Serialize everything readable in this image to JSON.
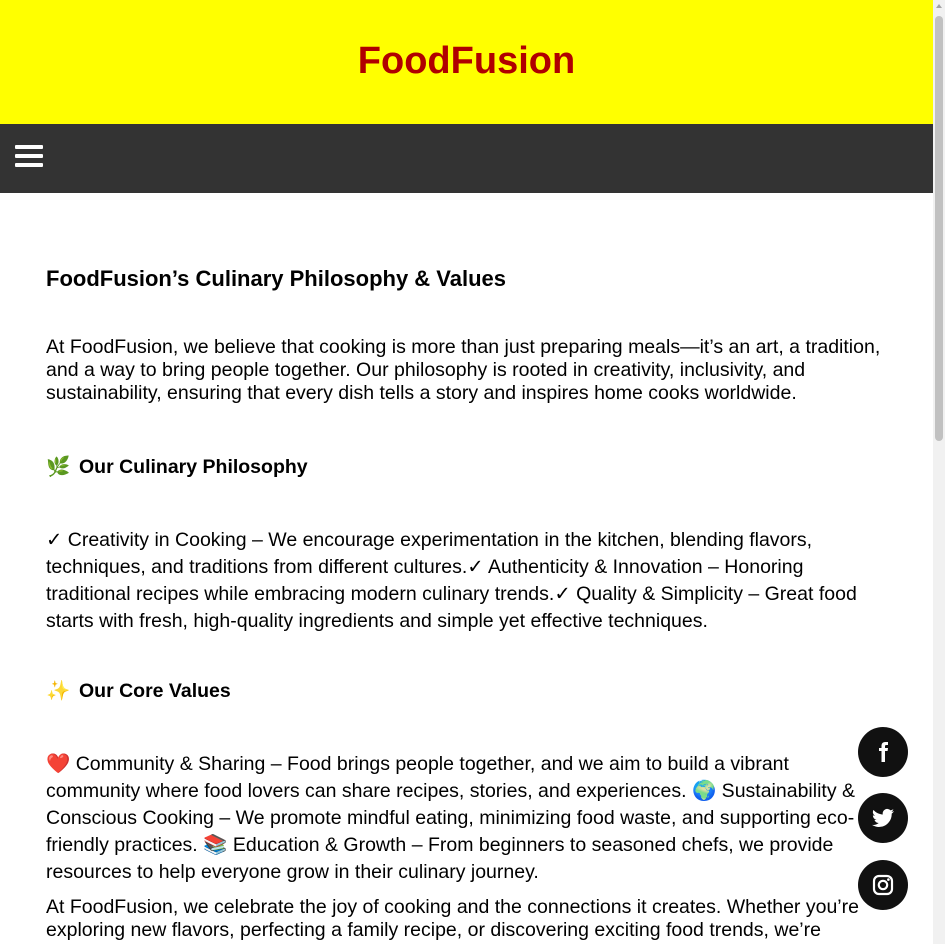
{
  "header": {
    "title": "FoodFusion"
  },
  "nav": {
    "menu_icon": "hamburger-menu-icon"
  },
  "main": {
    "heading": "FoodFusion’s Culinary Philosophy & Values",
    "intro": "At FoodFusion, we believe that cooking is more than just preparing meals—it’s an art, a tradition, and a way to bring people together. Our philosophy is rooted in creativity, inclusivity, and sustainability, ensuring that every dish tells a story and inspires home cooks worldwide.",
    "philosophy": {
      "emoji": "🌿",
      "title": "Our Culinary Philosophy",
      "items": [
        {
          "mark": "✓",
          "text": " Creativity in Cooking – We encourage experimentation in the kitchen, blending flavors, techniques, and traditions from different cultures."
        },
        {
          "mark": "✓",
          "text": " Authenticity & Innovation – Honoring traditional recipes while embracing modern culinary trends."
        },
        {
          "mark": "✓",
          "text": " Quality & Simplicity – Great food starts with fresh, high-quality ingredients and simple yet effective techniques."
        }
      ]
    },
    "values": {
      "emoji": "✨",
      "title": "Our Core Values",
      "items": [
        {
          "mark": "❤️",
          "text": " Community & Sharing – Food brings people together, and we aim to build a vibrant community where food lovers can share recipes, stories, and experiences."
        },
        {
          "mark": "🌍",
          "text": " Sustainability & Conscious Cooking – We promote mindful eating, minimizing food waste, and supporting eco-friendly practices."
        },
        {
          "mark": "📚",
          "text": " Education & Growth – From beginners to seasoned chefs, we provide resources to help everyone grow in their culinary journey."
        }
      ]
    },
    "outro": "At FoodFusion, we celebrate the joy of cooking and the connections it creates. Whether you’re exploring new flavors, perfecting a family recipe, or discovering exciting food trends, we’re"
  },
  "social": {
    "facebook": "facebook-icon",
    "twitter": "twitter-icon",
    "instagram": "instagram-icon"
  },
  "colors": {
    "header_bg": "#ffff00",
    "title": "#b00000",
    "nav_bg": "#333333",
    "social_bg": "#111111"
  }
}
